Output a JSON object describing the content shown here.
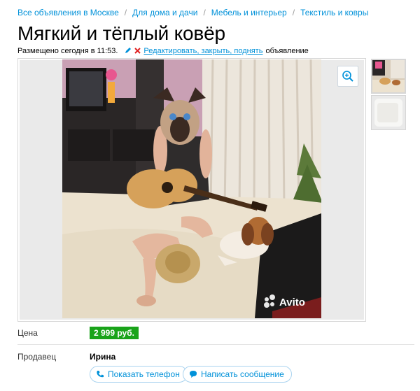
{
  "breadcrumbs": [
    {
      "label": "Все объявления в Москве"
    },
    {
      "label": "Для дома и дачи"
    },
    {
      "label": "Мебель и интерьер"
    },
    {
      "label": "Текстиль и ковры"
    }
  ],
  "breadcrumb_separator": "/",
  "title": "Мягкий и тёплый ковёр",
  "meta": {
    "posted": "Размещено сегодня в 11:53.",
    "edit_link": "Редактировать, закрыть, поднять",
    "tail": "объявление"
  },
  "gallery": {
    "watermark": "Avito",
    "zoom_icon": "zoom-in-icon",
    "thumbnails": 2
  },
  "price": {
    "label": "Цена",
    "value": "2 999 руб.",
    "badge_color": "#19a319"
  },
  "seller": {
    "label": "Продавец",
    "name": "Ирина"
  },
  "actions": {
    "show_phone": "Показать телефон",
    "write_message": "Написать сообщение"
  },
  "colors": {
    "link": "#0091d9",
    "price_bg": "#19a319"
  }
}
